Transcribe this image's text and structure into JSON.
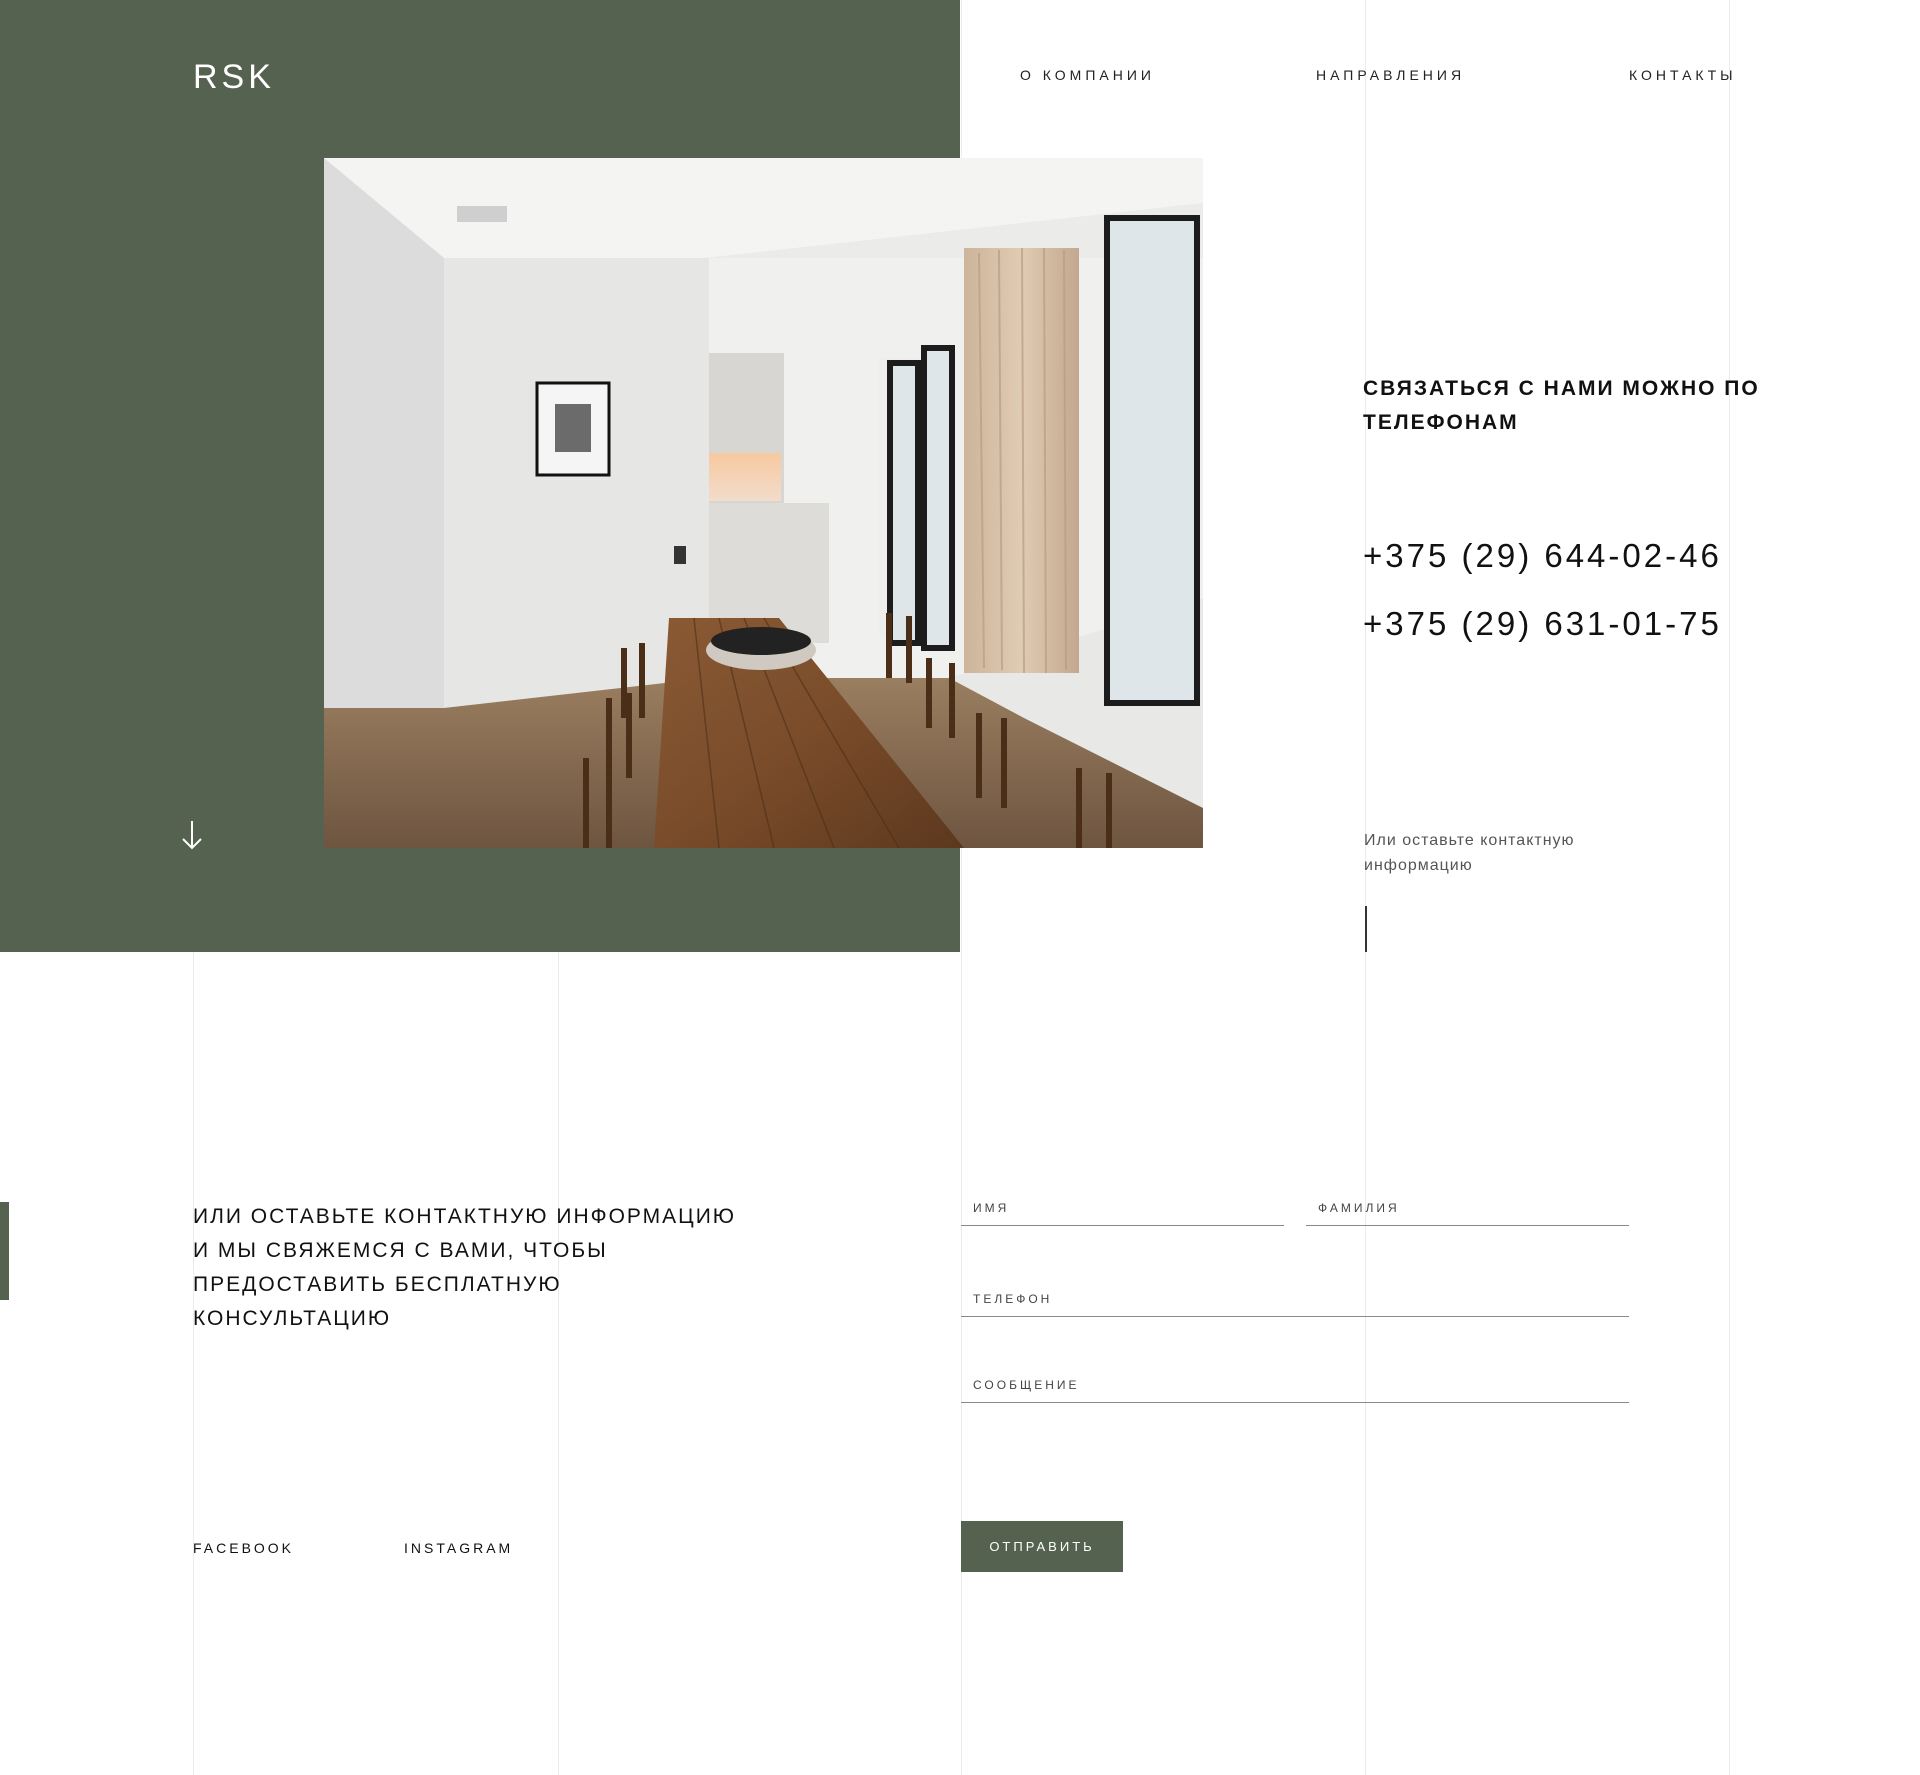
{
  "brand": {
    "logo": "RSK"
  },
  "nav": {
    "items": [
      {
        "label": "О КОМПАНИИ"
      },
      {
        "label": "НАПРАВЛЕНИЯ"
      },
      {
        "label": "КОНТАКТЫ"
      }
    ]
  },
  "hero": {
    "image_icon": "interior-dining-room-photo",
    "scroll_icon": "arrow-down-icon"
  },
  "contact": {
    "heading": "Связаться с нами можно по телефонам",
    "phones": [
      "+375 (29) 644-02-46",
      "+375 (29) 631-01-75"
    ],
    "note": "Или оставьте контактную информацию"
  },
  "form_section": {
    "intro": "Или оставьте контактную информацию и мы свяжемся с вами, чтобы предоставить бесплатную консультацию",
    "fields": {
      "first_name": {
        "placeholder": "ИМЯ",
        "value": ""
      },
      "last_name": {
        "placeholder": "ФАМИЛИЯ",
        "value": ""
      },
      "phone": {
        "placeholder": "ТЕЛЕФОН",
        "value": ""
      },
      "message": {
        "placeholder": "СООБЩЕНИЕ",
        "value": ""
      }
    },
    "submit_label": "ОТПРАВИТЬ"
  },
  "social": {
    "facebook": "FACEBOOK",
    "instagram": "INSTAGRAM"
  },
  "colors": {
    "accent": "#566250",
    "background": "#ffffff",
    "text": "#111111",
    "gridline": "#ececec"
  }
}
